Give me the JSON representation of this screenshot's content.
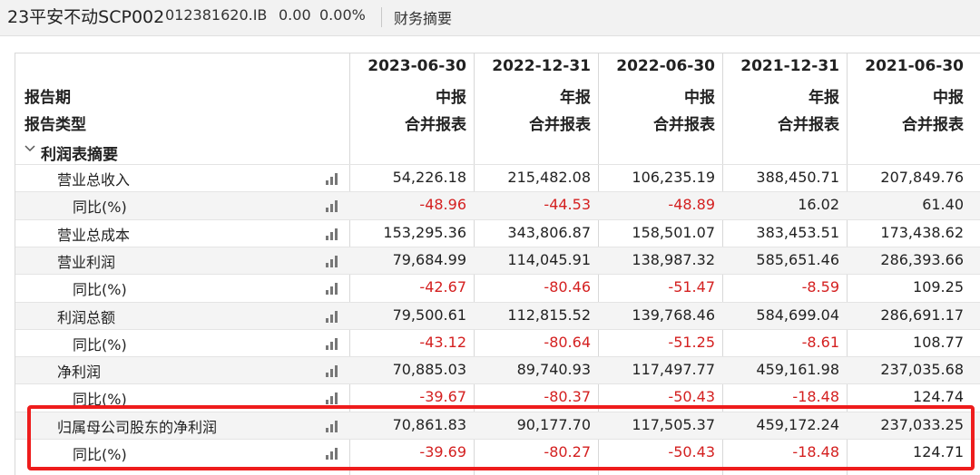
{
  "header": {
    "bond_name": "23平安不动SCP002",
    "bond_code": "012381620.IB",
    "price": "0.00",
    "change_pct": "0.00%",
    "section_title": "财务摘要"
  },
  "table": {
    "dates": [
      "2023-06-30",
      "2022-12-31",
      "2022-06-30",
      "2021-12-31",
      "2021-06-30"
    ],
    "report_period_label": "报告期",
    "report_periods": [
      "中报",
      "年报",
      "中报",
      "年报",
      "中报"
    ],
    "report_type_label": "报告类型",
    "report_types": [
      "合并报表",
      "合并报表",
      "合并报表",
      "合并报表",
      "合并报表"
    ],
    "section_label": "利润表摘要",
    "rows": [
      {
        "label": "营业总收入",
        "values": [
          "54,226.18",
          "215,482.08",
          "106,235.19",
          "388,450.71",
          "207,849.76"
        ]
      },
      {
        "label": "同比(%)",
        "values": [
          "-48.96",
          "-44.53",
          "-48.89",
          "16.02",
          "61.40"
        ]
      },
      {
        "label": "营业总成本",
        "values": [
          "153,295.36",
          "343,806.87",
          "158,501.07",
          "383,453.51",
          "173,438.62"
        ]
      },
      {
        "label": "营业利润",
        "values": [
          "79,684.99",
          "114,045.91",
          "138,987.32",
          "585,651.46",
          "286,393.66"
        ]
      },
      {
        "label": "同比(%)",
        "values": [
          "-42.67",
          "-80.46",
          "-51.47",
          "-8.59",
          "109.25"
        ]
      },
      {
        "label": "利润总额",
        "values": [
          "79,500.61",
          "112,815.52",
          "139,768.46",
          "584,699.04",
          "286,691.17"
        ]
      },
      {
        "label": "同比(%)",
        "values": [
          "-43.12",
          "-80.64",
          "-51.25",
          "-8.61",
          "108.77"
        ]
      },
      {
        "label": "净利润",
        "values": [
          "70,885.03",
          "89,740.93",
          "117,497.77",
          "459,161.98",
          "237,035.68"
        ]
      },
      {
        "label": "同比(%)",
        "values": [
          "-39.67",
          "-80.37",
          "-50.43",
          "-18.48",
          "124.74"
        ]
      },
      {
        "label": "归属母公司股东的净利润",
        "values": [
          "70,861.83",
          "90,177.70",
          "117,505.37",
          "459,172.24",
          "237,033.25"
        ]
      },
      {
        "label": "同比(%)",
        "values": [
          "-39.69",
          "-80.27",
          "-50.43",
          "-18.48",
          "124.71"
        ]
      }
    ]
  },
  "colors": {
    "negative": "#d42020",
    "highlight_border": "#ee1c1c"
  },
  "icons": {
    "chart": "bar-chart-icon",
    "collapse": "chevron-down-icon"
  }
}
